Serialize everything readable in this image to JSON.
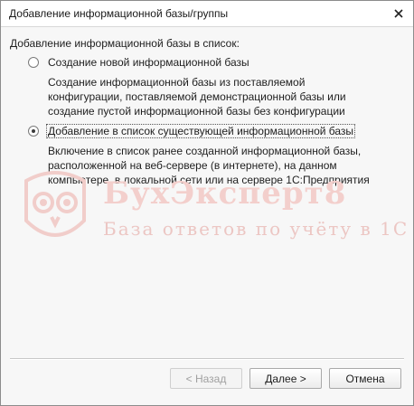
{
  "window": {
    "title": "Добавление информационной базы/группы",
    "close_icon": "close-icon"
  },
  "form": {
    "heading": "Добавление информационной базы в список:",
    "options": [
      {
        "label": "Создание новой информационной базы",
        "selected": false,
        "description": [
          "Создание информационной базы из поставляемой",
          "конфигурации, поставляемой демонстрационной базы или",
          "создание пустой информационной базы без конфигурации"
        ]
      },
      {
        "label": "Добавление в список существующей информационной базы",
        "selected": true,
        "description": [
          "Включение в список ранее созданной информационной базы,",
          "расположенной на веб-сервере (в интернете), на данном",
          "компьютере,  в локальной сети или на сервере 1С:Предприятия"
        ]
      }
    ]
  },
  "watermark": {
    "brand": "БухЭксперт8",
    "tagline": "База ответов по учёту в 1С",
    "color": "#e9b3ae"
  },
  "buttons": {
    "back": "< Назад",
    "next": "Далее >",
    "cancel": "Отмена"
  }
}
